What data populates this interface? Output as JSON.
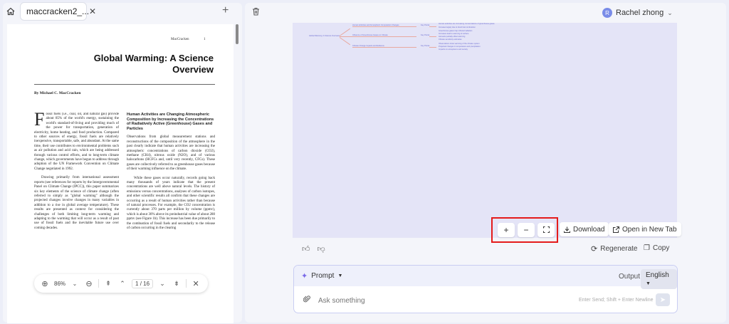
{
  "left": {
    "tab_title": "maccracken2_...",
    "pdf": {
      "header_left": "MacCracken",
      "header_right": "1",
      "title_line1": "Global Warming: A Science",
      "title_line2": "Overview",
      "author": "By Michael C. MacCracken",
      "col1_p1_dropcap": "F",
      "col1_p1": "ossil fuels (i.e., coal, oil, and natural gas) provide about 85% of the world's energy, sustaining the world's standard-of-living and providing much of the power for transportation, generation of electricity, home heating, and food production. Compared to other sources of energy, fossil fuels are relatively inexpensive, transportable, safe, and abundant. At the same time, their use contributes to environmental problems such as air pollution and acid rain, which are being addressed through various control efforts, and to long-term climate change, which governments have begun to address through adoption of the UN Framework Convention on Climate Change negotiated in 1992.",
      "col1_p2": "Drawing primarily from international assessment reports (see references for reports by the Intergovernmental Panel on Climate Change (IPCC)), this paper summarizes six key elements of the science of climate change (often referred to simply as \"global warming\" although the projected changes involve changes in many variables in addition to a rise in global average temperature). These results are presented as context for considering the challenges of both limiting long-term warming and adapting to the warming that will occur as a result of past use of fossil fuels and the inevitable future use over coming decades.",
      "col2_heading": "Human Activities are Changing Atmospheric Composition by Increasing the Concentrations of Radiatively Active (Greenhouse) Gases and Particles",
      "col2_p1": "Observations from global measurement stations and reconstructions of the composition of the atmosphere in the past clearly indicate that human activities are increasing the atmospheric concentrations of carbon dioxide (CO2), methane (CH4), nitrous oxide (N2O), and of various halocarbons (HCFCs and, until very recently, CFCs). These gases are collectively referred to as greenhouse gases because of their warming influence on the climate.",
      "col2_p2": "While these gases occur naturally, records going back many thousands of years indicate that the present concentrations are well above natural levels. The history of emissions versus concentrations, analyses of carbon isotopes, and other scientific results all confirm that these changes are occurring as a result of human activities rather than because of natural processes. For example, the CO2 concentration is currently about 370 parts per million by volume (ppmv), which is about 30% above its preindustrial value of about 280 ppmv (see Figure 1b). This increase has been due primarily to the combustion of fossil fuels and secondarily to the release of carbon occurring in the clearing"
    },
    "toolbar": {
      "zoom": "86%",
      "page_current": "1",
      "page_sep": "/",
      "page_total": "16"
    }
  },
  "right": {
    "user_initial": "R",
    "user_name": "Rachel zhong",
    "mindmap": {
      "root": "Global Warming: A Science Overview",
      "branches": [
        {
          "label": "Human Activities and Atmospheric Composition Changes",
          "sub": "Key Points",
          "details": [
            "Human activities are increasing concentrations of greenhouse gases",
            "Increase largely due to fossil fuel combustion"
          ]
        },
        {
          "label": "Influence of Greenhouse Gases on Climate",
          "sub": "Key Points",
          "details": [
            "Greenhouse gases trap infrared radiation",
            "Increases lead to warming of surface",
            "Aerosols partially offset warming",
            "Climate sensitivity estimates"
          ]
        },
        {
          "label": "Climate Change Impacts and Evidence",
          "sub": "Key Points",
          "details": [
            "Observations show warming of the climate system",
            "Projected changes in temperature and precipitation",
            "Impacts on ecosystems and society"
          ]
        }
      ]
    },
    "controls": {
      "download": "Download",
      "open_new_tab": "Open in New Tab",
      "regenerate": "Regenerate",
      "copy": "Copy"
    },
    "input": {
      "prompt_label": "Prompt",
      "output_label": "Output",
      "language": "English",
      "placeholder": "Ask something",
      "hint": "Enter Send; Shift + Enter Newline"
    }
  }
}
